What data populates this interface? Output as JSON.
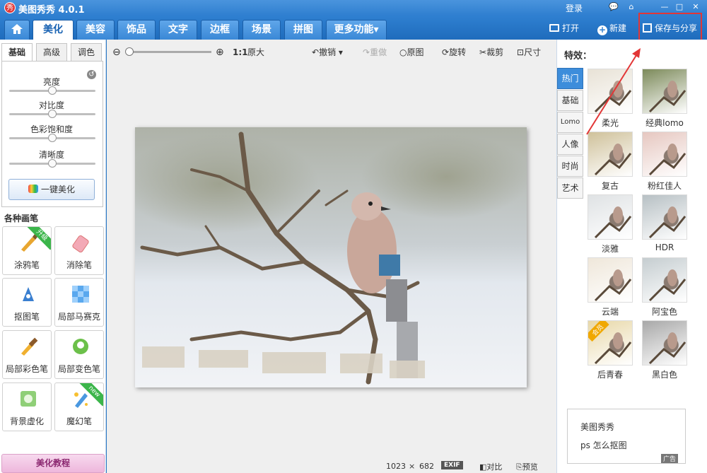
{
  "app": {
    "logo_text": "秀",
    "title": "美图秀秀 4.0.1",
    "login": "登录"
  },
  "window_buttons": [
    "💬",
    "⌂",
    "—",
    "□",
    "✕"
  ],
  "tabs": [
    "美化",
    "美容",
    "饰品",
    "文字",
    "边框",
    "场景",
    "拼图",
    "更多功能"
  ],
  "more_arrow": "▾",
  "top_actions": {
    "open": "打开",
    "new": "新建",
    "save": "保存与分享"
  },
  "subtabs": [
    "基础",
    "高级",
    "调色"
  ],
  "sliders": [
    {
      "label": "亮度",
      "value": 0.5
    },
    {
      "label": "对比度",
      "value": 0.5
    },
    {
      "label": "色彩饱和度",
      "value": 0.5
    },
    {
      "label": "清晰度",
      "value": 0.5
    }
  ],
  "oneclick": "一键美化",
  "brushes_title": "各种画笔",
  "brushes": [
    {
      "label": "涂鸦笔",
      "badge": "升级"
    },
    {
      "label": "消除笔",
      "badge": ""
    },
    {
      "label": "抠图笔",
      "badge": ""
    },
    {
      "label": "局部马赛克",
      "badge": ""
    },
    {
      "label": "局部彩色笔",
      "badge": ""
    },
    {
      "label": "局部变色笔",
      "badge": ""
    },
    {
      "label": "背景虚化",
      "badge": ""
    },
    {
      "label": "魔幻笔",
      "badge": "new"
    }
  ],
  "tutorial": "美化教程",
  "toolbar": {
    "zoom_ratio": "1:1",
    "original_size": "原大",
    "undo": "撤销",
    "redo": "重做",
    "original": "原图",
    "rotate": "旋转",
    "crop": "裁剪",
    "size": "尺寸"
  },
  "status": {
    "width": "1023",
    "times": "×",
    "height": "682",
    "exif": "EXIF",
    "compare": "对比",
    "preview": "预览"
  },
  "effects_title": "特效：",
  "effect_tabs": [
    "热门",
    "基础",
    "Lomo",
    "人像",
    "时尚",
    "艺术"
  ],
  "effects": [
    {
      "label": "柔光",
      "tint": "#e8e2d6",
      "badge": ""
    },
    {
      "label": "经典lomo",
      "tint": "#7c8a5a",
      "badge": ""
    },
    {
      "label": "复古",
      "tint": "#cfc19a",
      "badge": ""
    },
    {
      "label": "粉红佳人",
      "tint": "#e6c7c0",
      "badge": ""
    },
    {
      "label": "淡雅",
      "tint": "#dfe2e4",
      "badge": ""
    },
    {
      "label": "HDR",
      "tint": "#b7c0c4",
      "badge": ""
    },
    {
      "label": "云端",
      "tint": "#efe7da",
      "badge": ""
    },
    {
      "label": "阿宝色",
      "tint": "#c5cdd0",
      "badge": ""
    },
    {
      "label": "后青春",
      "tint": "#e8d8a8",
      "badge": "会员"
    },
    {
      "label": "黑白色",
      "tint": "#a8a8a8",
      "badge": ""
    }
  ],
  "ad": {
    "items": [
      "美图秀秀",
      "ps 怎么抠图"
    ],
    "tag": "广告"
  },
  "colors": {
    "accent": "#2b78c5",
    "highlight": "#e23636"
  }
}
